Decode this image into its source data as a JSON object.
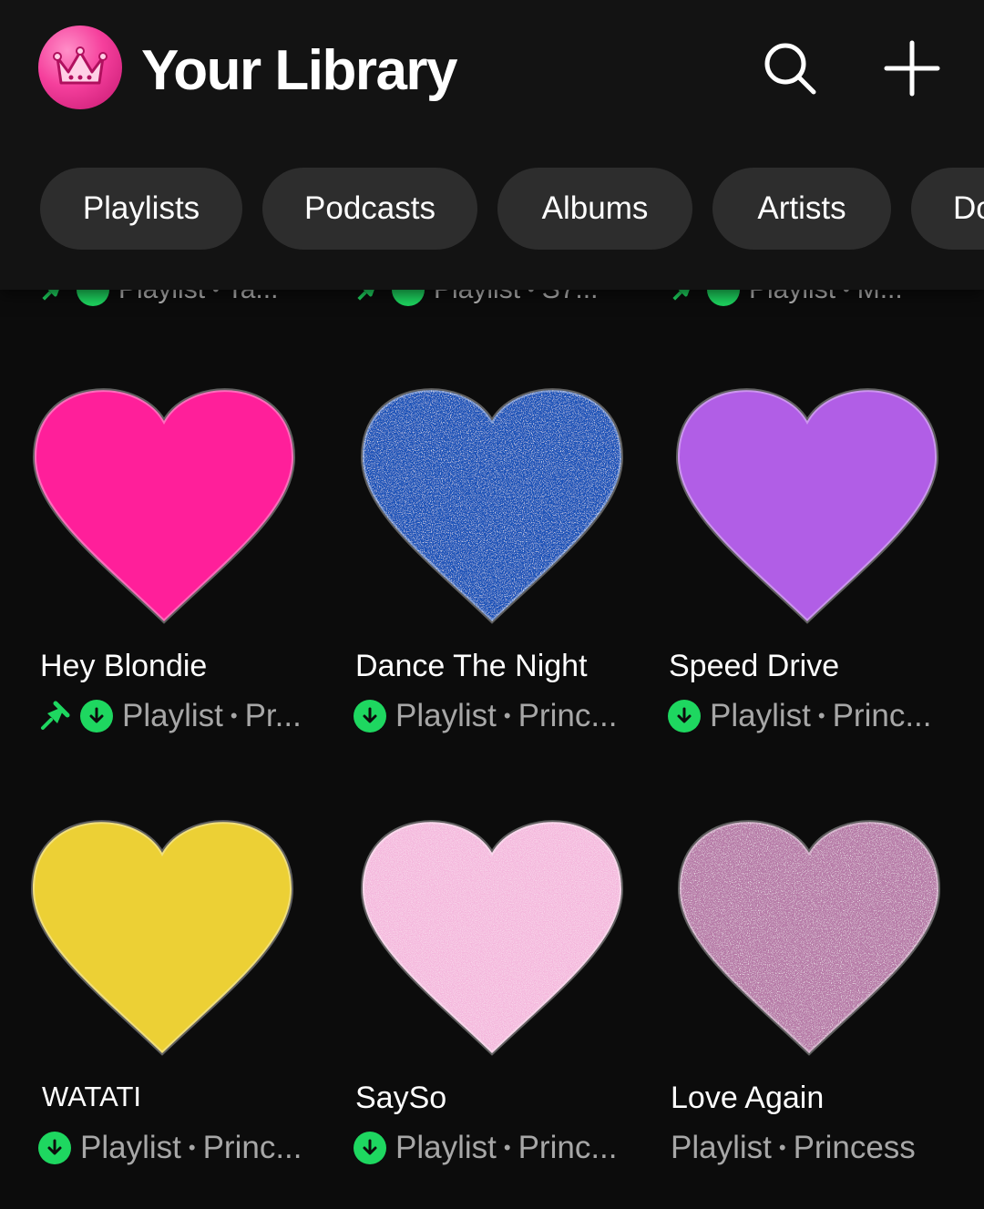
{
  "header": {
    "title": "Your Library"
  },
  "filters": [
    {
      "label": "Playlists"
    },
    {
      "label": "Podcasts"
    },
    {
      "label": "Albums"
    },
    {
      "label": "Artists"
    },
    {
      "label": "Do"
    }
  ],
  "peek_row": [
    {
      "type": "Playlist",
      "rest": "Ta..."
    },
    {
      "type": "Playlist",
      "rest": "S7..."
    },
    {
      "type": "Playlist",
      "rest": "M..."
    }
  ],
  "items": [
    {
      "title": "Hey Blondie",
      "type": "Playlist",
      "owner": "Pr...",
      "pinned": true,
      "downloaded": true,
      "art_color": "#ff1f9a",
      "art_style": "matte"
    },
    {
      "title": "Dance The Night",
      "type": "Playlist",
      "owner": "Princ...",
      "pinned": false,
      "downloaded": true,
      "art_color": "#1d52b8",
      "art_style": "glitter"
    },
    {
      "title": "Speed Drive",
      "type": "Playlist",
      "owner": "Princ...",
      "pinned": false,
      "downloaded": true,
      "art_color": "#b15ee6",
      "art_style": "matte"
    },
    {
      "title": "WATATI",
      "type": "Playlist",
      "owner": "Princ...",
      "pinned": false,
      "downloaded": true,
      "art_color": "#ecd035",
      "art_style": "matte"
    },
    {
      "title": "SaySo",
      "type": "Playlist",
      "owner": "Princ...",
      "pinned": false,
      "downloaded": true,
      "art_color": "#f4b6dc",
      "art_style": "shimmer"
    },
    {
      "title": "Love Again",
      "type": "Playlist",
      "owner": "Princess",
      "pinned": false,
      "downloaded": false,
      "art_color": "#b77ba8",
      "art_style": "glitter"
    }
  ],
  "colors": {
    "background": "#0c0c0c",
    "chip": "#2d2d2d",
    "accent_green": "#1ed760",
    "avatar_pink": "#f53f9c"
  },
  "icons": {
    "avatar": "crown-icon",
    "search": "search-icon",
    "add": "plus-icon",
    "pin": "pin-icon",
    "download": "download-icon"
  }
}
